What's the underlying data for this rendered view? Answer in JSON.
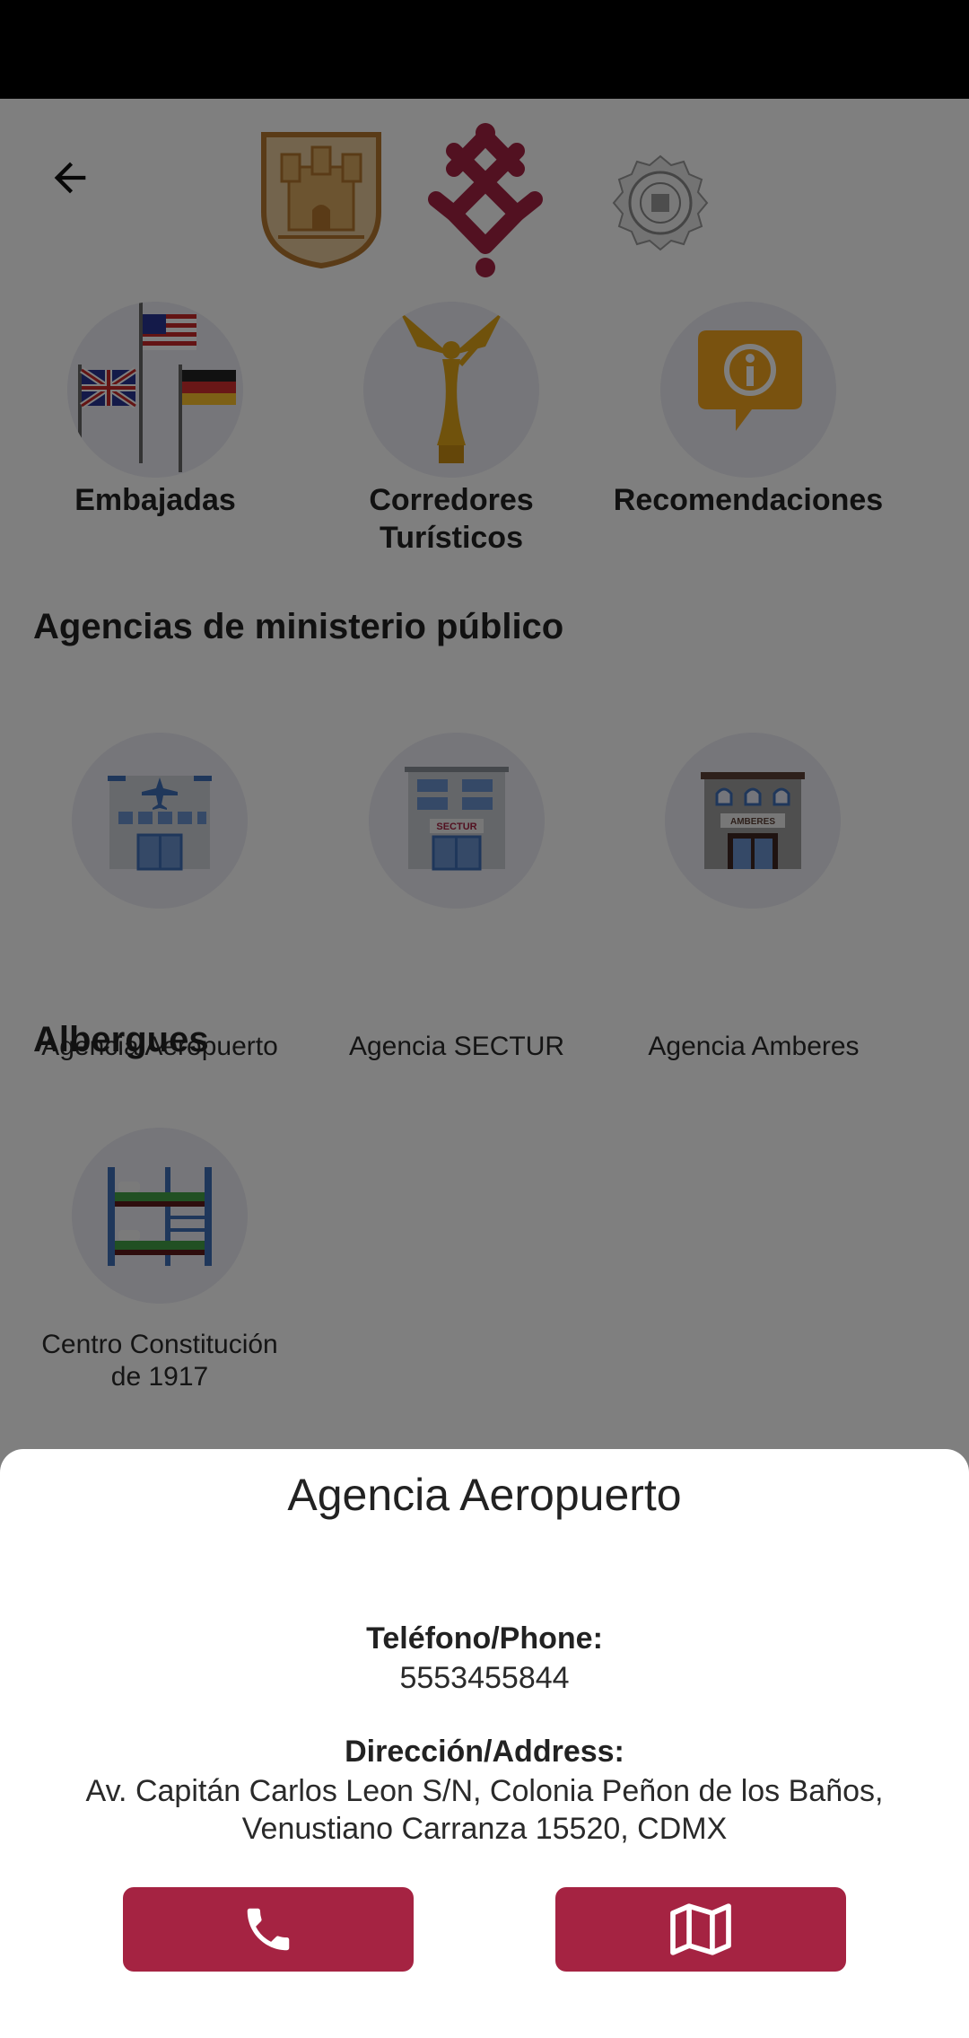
{
  "colors": {
    "brand": "#a52342",
    "accent_orange": "#e8a31c",
    "overlay": "rgba(0,0,0,0.5)"
  },
  "header": {
    "back_icon": "arrow-left-icon",
    "logos": [
      "cdmx-coat-of-arms-logo",
      "cdmx-brand-logo",
      "police-seal-logo"
    ]
  },
  "categories": [
    {
      "label_line1": "Embajadas",
      "label_line2": "",
      "icon": "flags-icon"
    },
    {
      "label_line1": "Corredores",
      "label_line2": "Turísticos",
      "icon": "angel-statue-icon"
    },
    {
      "label_line1": "Recomendaciones",
      "label_line2": "",
      "icon": "info-chat-icon"
    }
  ],
  "sections": [
    {
      "title": "Agencias de ministerio público",
      "items": [
        {
          "label": "Agencia Aeropuerto",
          "icon": "airport-building-icon"
        },
        {
          "label": "Agencia SECTUR",
          "icon": "sectur-building-icon",
          "sign": "SECTUR"
        },
        {
          "label": "Agencia Amberes",
          "icon": "amberes-building-icon",
          "sign": "AMBERES"
        }
      ]
    },
    {
      "title": "Albergues",
      "items": [
        {
          "label_line1": "Centro Constitución",
          "label_line2": "de 1917",
          "icon": "bunk-bed-icon"
        }
      ]
    }
  ],
  "sheet": {
    "title": "Agencia Aeropuerto",
    "phone_label": "Teléfono/Phone:",
    "phone_value": "5553455844",
    "address_label": "Dirección/Address:",
    "address_line1": "Av. Capitán Carlos Leon S/N, Colonia Peñon de los Baños,",
    "address_line2": "Venustiano Carranza 15520, CDMX",
    "call_icon": "phone-icon",
    "map_icon": "map-icon"
  }
}
